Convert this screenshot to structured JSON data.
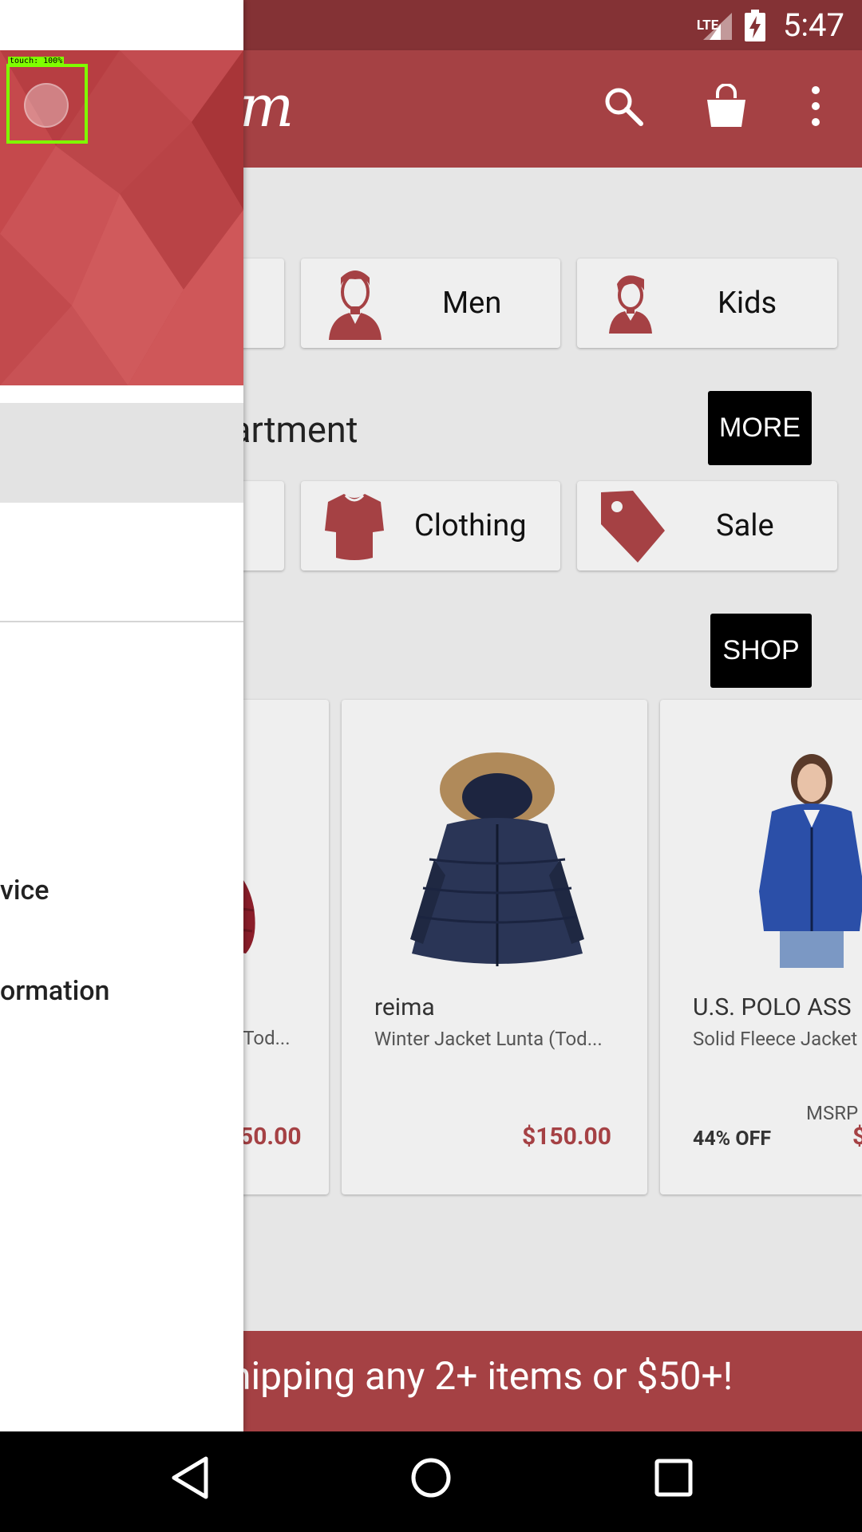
{
  "status_bar": {
    "network": "LTE",
    "time": "5:47"
  },
  "app_bar": {
    "logo_fragment": "m",
    "icons": [
      "search-icon",
      "shopping-bag-icon",
      "overflow-menu-icon"
    ]
  },
  "categories": [
    {
      "label": "Men",
      "icon": "man-icon"
    },
    {
      "label": "Kids",
      "icon": "kid-icon"
    }
  ],
  "department_section": {
    "title": "artment",
    "more_label": "MORE"
  },
  "departments": [
    {
      "label": "Clothing",
      "icon": "shirt-icon"
    },
    {
      "label": "Sale",
      "icon": "tag-icon"
    }
  ],
  "shop_section": {
    "shop_label": "SHOP"
  },
  "products": [
    {
      "brand": "",
      "name": "(Tod...",
      "price": "50.00"
    },
    {
      "brand": "reima",
      "name": "Winter Jacket Lunta (Tod...",
      "price": "$150.00"
    },
    {
      "brand": "U.S. POLO ASS",
      "name": "Solid Fleece Jacket",
      "msrp_label": "MSRP",
      "discount": "44% OFF",
      "price": "$"
    }
  ],
  "promo": {
    "text": "hipping any 2+ items or $50+!"
  },
  "drawer": {
    "touch_overlay": "touch: 100%",
    "items": [
      "vice",
      "ormation"
    ]
  },
  "colors": {
    "brand": "#a54144",
    "status_bar": "#843235",
    "drawer_header": "#c04a4d"
  }
}
